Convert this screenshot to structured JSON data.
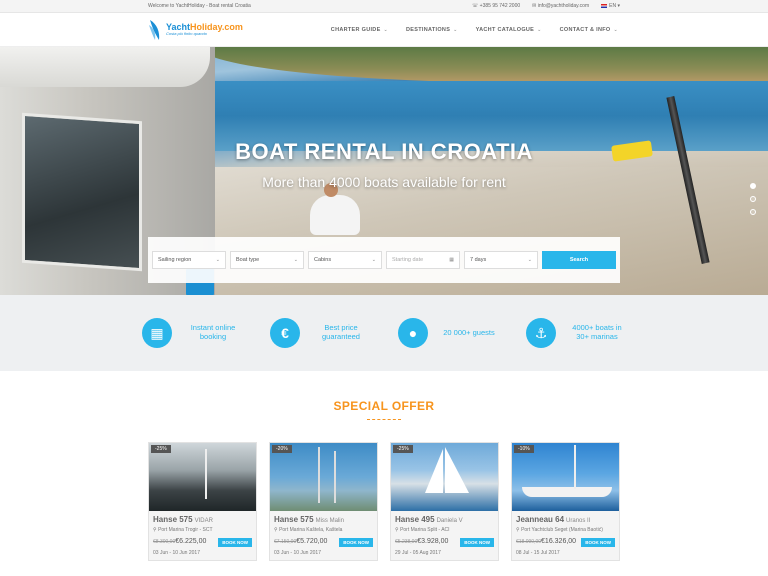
{
  "topbar": {
    "welcome": "Welcome to YachtHoliday - Boat rental Croatia",
    "phone": "+385 95 742 2000",
    "email": "info@yachtholiday.com",
    "lang": "EN"
  },
  "logo": {
    "name_a": "Yacht",
    "name_b": "Holiday.com",
    "tagline": "Costa più finito quando"
  },
  "nav": [
    {
      "label": "CHARTER GUIDE"
    },
    {
      "label": "DESTINATIONS"
    },
    {
      "label": "YACHT CATALOGUE"
    },
    {
      "label": "CONTACT & INFO"
    }
  ],
  "hero": {
    "title": "BOAT RENTAL IN CROATIA",
    "subtitle": "More than 4000 boats available for rent"
  },
  "search": {
    "region": "Sailing region",
    "boat_type": "Boat type",
    "cabins": "Cabins",
    "date_placeholder": "Starting date",
    "duration": "7 days",
    "button": "Search"
  },
  "features": [
    {
      "icon": "calendar-icon",
      "glyph": "▦",
      "label": "Instant online booking"
    },
    {
      "icon": "euro-icon",
      "glyph": "€",
      "label": "Best price guaranteed"
    },
    {
      "icon": "guests-icon",
      "glyph": "●",
      "label": "20 000+ guests"
    },
    {
      "icon": "anchor-icon",
      "glyph": "⚓",
      "label": "4000+ boats in 30+ marinas"
    }
  ],
  "offer": {
    "title": "SPECIAL OFFER",
    "cards": [
      {
        "badge": "-25%",
        "model": "Hanse 575",
        "name": "VIDAR",
        "location": "Port Marina Trogir - SCT",
        "old_price": "€8.300,00",
        "price": "€6.225,00",
        "book": "BOOK NOW",
        "dates": "03 Jun - 10 Jun 2017"
      },
      {
        "badge": "-20%",
        "model": "Hanse 575",
        "name": "Miss Malin",
        "location": "Port Marina Kaštela, Kaštela",
        "old_price": "€7.150,00",
        "price": "€5.720,00",
        "book": "BOOK NOW",
        "dates": "03 Jun - 10 Jun 2017"
      },
      {
        "badge": "-25%",
        "model": "Hanse 495",
        "name": "Daniela V",
        "location": "Port Marina Split - ACI",
        "old_price": "€5.238,00",
        "price": "€3.928,00",
        "book": "BOOK NOW",
        "dates": "29 Jul - 05 Aug 2017"
      },
      {
        "badge": "-10%",
        "model": "Jeanneau 64",
        "name": "Uranos II",
        "location": "Port Yachtclub Seget (Marina Baotić)",
        "old_price": "€18.090,00",
        "price": "€16.326,00",
        "book": "BOOK NOW",
        "dates": "08 Jul - 15 Jul 2017"
      }
    ]
  },
  "colors": {
    "accent": "#29b6ea",
    "orange": "#f7941d"
  }
}
